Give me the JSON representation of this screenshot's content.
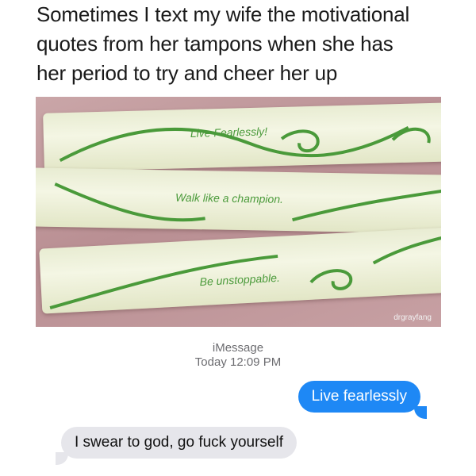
{
  "caption": {
    "line1": "Sometimes I text my wife the motivational",
    "line2": "quotes from her tampons when she has",
    "line3": "her period to try and cheer her up"
  },
  "photo": {
    "wrappers": [
      {
        "quote": "Live Fearlessly!"
      },
      {
        "quote": "Walk like a champion."
      },
      {
        "quote": "Be unstoppable."
      }
    ],
    "credit": "drgrayfang",
    "colors": {
      "wrapper": "#eef1da",
      "print": "#4a9a3a",
      "background": "#c19b9e"
    }
  },
  "imessage": {
    "service": "iMessage",
    "timestamp": "Today 12:09 PM",
    "sent": "Live fearlessly",
    "received": "I swear to god, go fuck yourself",
    "colors": {
      "sent_bubble": "#1e88f5",
      "received_bubble": "#e6e6eb"
    }
  }
}
